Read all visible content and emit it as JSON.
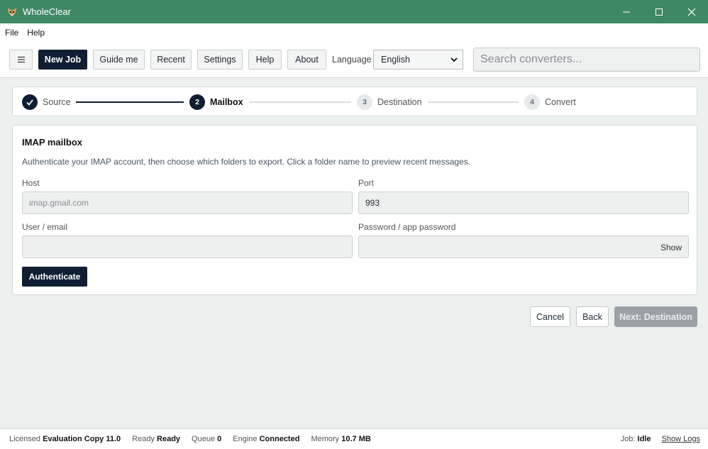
{
  "app": {
    "title": "WholeClear"
  },
  "menu": {
    "file": "File",
    "help": "Help"
  },
  "toolbar": {
    "new_job": "New Job",
    "guide": "Guide me",
    "recent": "Recent",
    "settings": "Settings",
    "help": "Help",
    "about": "About",
    "language_label": "Language",
    "language_value": "English",
    "search_placeholder": "Search converters..."
  },
  "steps": [
    {
      "num": "✓",
      "label": "Source",
      "state": "done"
    },
    {
      "num": "2",
      "label": "Mailbox",
      "state": "active"
    },
    {
      "num": "3",
      "label": "Destination",
      "state": "pending"
    },
    {
      "num": "4",
      "label": "Convert",
      "state": "pending"
    }
  ],
  "form": {
    "title": "IMAP mailbox",
    "description": "Authenticate your IMAP account, then choose which folders to export. Click a folder name to preview recent messages.",
    "host_label": "Host",
    "host_placeholder": "imap.gmail.com",
    "port_label": "Port",
    "port_value": "993",
    "user_label": "User / email",
    "user_value": "",
    "password_label": "Password / app password",
    "password_value": "",
    "show_label": "Show",
    "authenticate": "Authenticate"
  },
  "actions": {
    "cancel": "Cancel",
    "back": "Back",
    "next": "Next: Destination"
  },
  "status": {
    "licensed_label": "Licensed",
    "licensed_value": "Evaluation Copy 11.0",
    "ready_label": "Ready",
    "ready_value": "Ready",
    "queue_label": "Queue",
    "queue_value": "0",
    "engine_label": "Engine",
    "engine_value": "Connected",
    "memory_label": "Memory",
    "memory_value": "10.7 MB",
    "job_label": "Job:",
    "job_value": "Idle",
    "show_logs": "Show Logs"
  },
  "colors": {
    "titlebar": "#3f8866",
    "accent_dark": "#0f1e33",
    "disabled": "#9aa2a8"
  }
}
